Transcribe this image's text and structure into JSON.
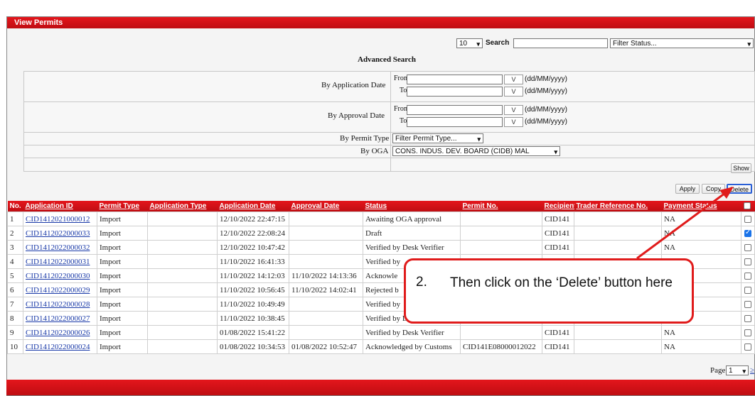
{
  "window": {
    "title": "View Permits"
  },
  "filters": {
    "page_size": "10",
    "search_label": "Search",
    "search_value": "",
    "status_placeholder": "Filter Status..."
  },
  "advanced": {
    "title": "Advanced Search",
    "by_application_date": "By Application Date",
    "by_approval_date": "By Approval Date",
    "from_label": "From",
    "to_label": "To",
    "cal_label": "V",
    "date_format": "(dd/MM/yyyy)",
    "by_permit_type": "By Permit Type",
    "permit_type_placeholder": "Filter Permit Type...",
    "by_oga": "By OGA",
    "oga_value": "CONS. INDUS. DEV. BOARD (CIDB) MAL"
  },
  "actions": {
    "show": "Show",
    "apply": "Apply",
    "copy": "Copy",
    "delete": "Delete"
  },
  "table": {
    "headers": [
      "No.",
      "Application ID",
      "Permit Type",
      "Application Type",
      "Application Date",
      "Approval Date",
      "Status",
      "Permit No.",
      "Recipient",
      "Trader Reference No.",
      "Payment Status"
    ],
    "rows": [
      {
        "no": "1",
        "id": "CID1412021000012",
        "type": "Import",
        "app_type": "",
        "app_date": "12/10/2022 22:47:15",
        "appr_date": "",
        "status": "Awaiting OGA approval",
        "permit": "",
        "recipient": "CID141",
        "ref": "",
        "pay": "NA",
        "checked": false
      },
      {
        "no": "2",
        "id": "CID1412022000033",
        "type": "Import",
        "app_type": "",
        "app_date": "12/10/2022 22:08:24",
        "appr_date": "",
        "status": "Draft",
        "permit": "",
        "recipient": "CID141",
        "ref": "",
        "pay": "NA",
        "checked": true
      },
      {
        "no": "3",
        "id": "CID1412022000032",
        "type": "Import",
        "app_type": "",
        "app_date": "12/10/2022 10:47:42",
        "appr_date": "",
        "status": "Verified by Desk Verifier",
        "permit": "",
        "recipient": "CID141",
        "ref": "",
        "pay": "NA",
        "checked": false
      },
      {
        "no": "4",
        "id": "CID1412022000031",
        "type": "Import",
        "app_type": "",
        "app_date": "11/10/2022 16:41:33",
        "appr_date": "",
        "status": "Verified by",
        "permit": "",
        "recipient": "",
        "ref": "",
        "pay": "",
        "checked": false
      },
      {
        "no": "5",
        "id": "CID1412022000030",
        "type": "Import",
        "app_type": "",
        "app_date": "11/10/2022 14:12:03",
        "appr_date": "11/10/2022 14:13:36",
        "status": "Acknowle",
        "permit": "",
        "recipient": "",
        "ref": "",
        "pay": "",
        "checked": false
      },
      {
        "no": "6",
        "id": "CID1412022000029",
        "type": "Import",
        "app_type": "",
        "app_date": "11/10/2022 10:56:45",
        "appr_date": "11/10/2022 14:02:41",
        "status": "Rejected b",
        "permit": "",
        "recipient": "",
        "ref": "",
        "pay": "",
        "checked": false
      },
      {
        "no": "7",
        "id": "CID1412022000028",
        "type": "Import",
        "app_type": "",
        "app_date": "11/10/2022 10:49:49",
        "appr_date": "",
        "status": "Verified by",
        "permit": "",
        "recipient": "",
        "ref": "",
        "pay": "",
        "checked": false
      },
      {
        "no": "8",
        "id": "CID1412022000027",
        "type": "Import",
        "app_type": "",
        "app_date": "11/10/2022 10:38:45",
        "appr_date": "",
        "status": "Verified by Desk Verifier",
        "permit": "",
        "recipient": "CID141",
        "ref": "",
        "pay": "NA",
        "checked": false
      },
      {
        "no": "9",
        "id": "CID1412022000026",
        "type": "Import",
        "app_type": "",
        "app_date": "01/08/2022 15:41:22",
        "appr_date": "",
        "status": "Verified by Desk Verifier",
        "permit": "",
        "recipient": "CID141",
        "ref": "",
        "pay": "NA",
        "checked": false
      },
      {
        "no": "10",
        "id": "CID1412022000024",
        "type": "Import",
        "app_type": "",
        "app_date": "01/08/2022 10:34:53",
        "appr_date": "01/08/2022 10:52:47",
        "status": "Acknowledged by Customs",
        "permit": "CID141E08000012022",
        "recipient": "CID141",
        "ref": "",
        "pay": "NA",
        "checked": false
      }
    ]
  },
  "pager": {
    "label": "Page",
    "value": "1",
    "next": "≥"
  },
  "annotation": {
    "number": "2.",
    "text": "Then click on the ‘Delete’ button here"
  },
  "colors": {
    "header_red": "#d11218",
    "link_blue": "#1a3aa8",
    "callout_red": "#e01b1b",
    "check_blue": "#1a73e8"
  }
}
